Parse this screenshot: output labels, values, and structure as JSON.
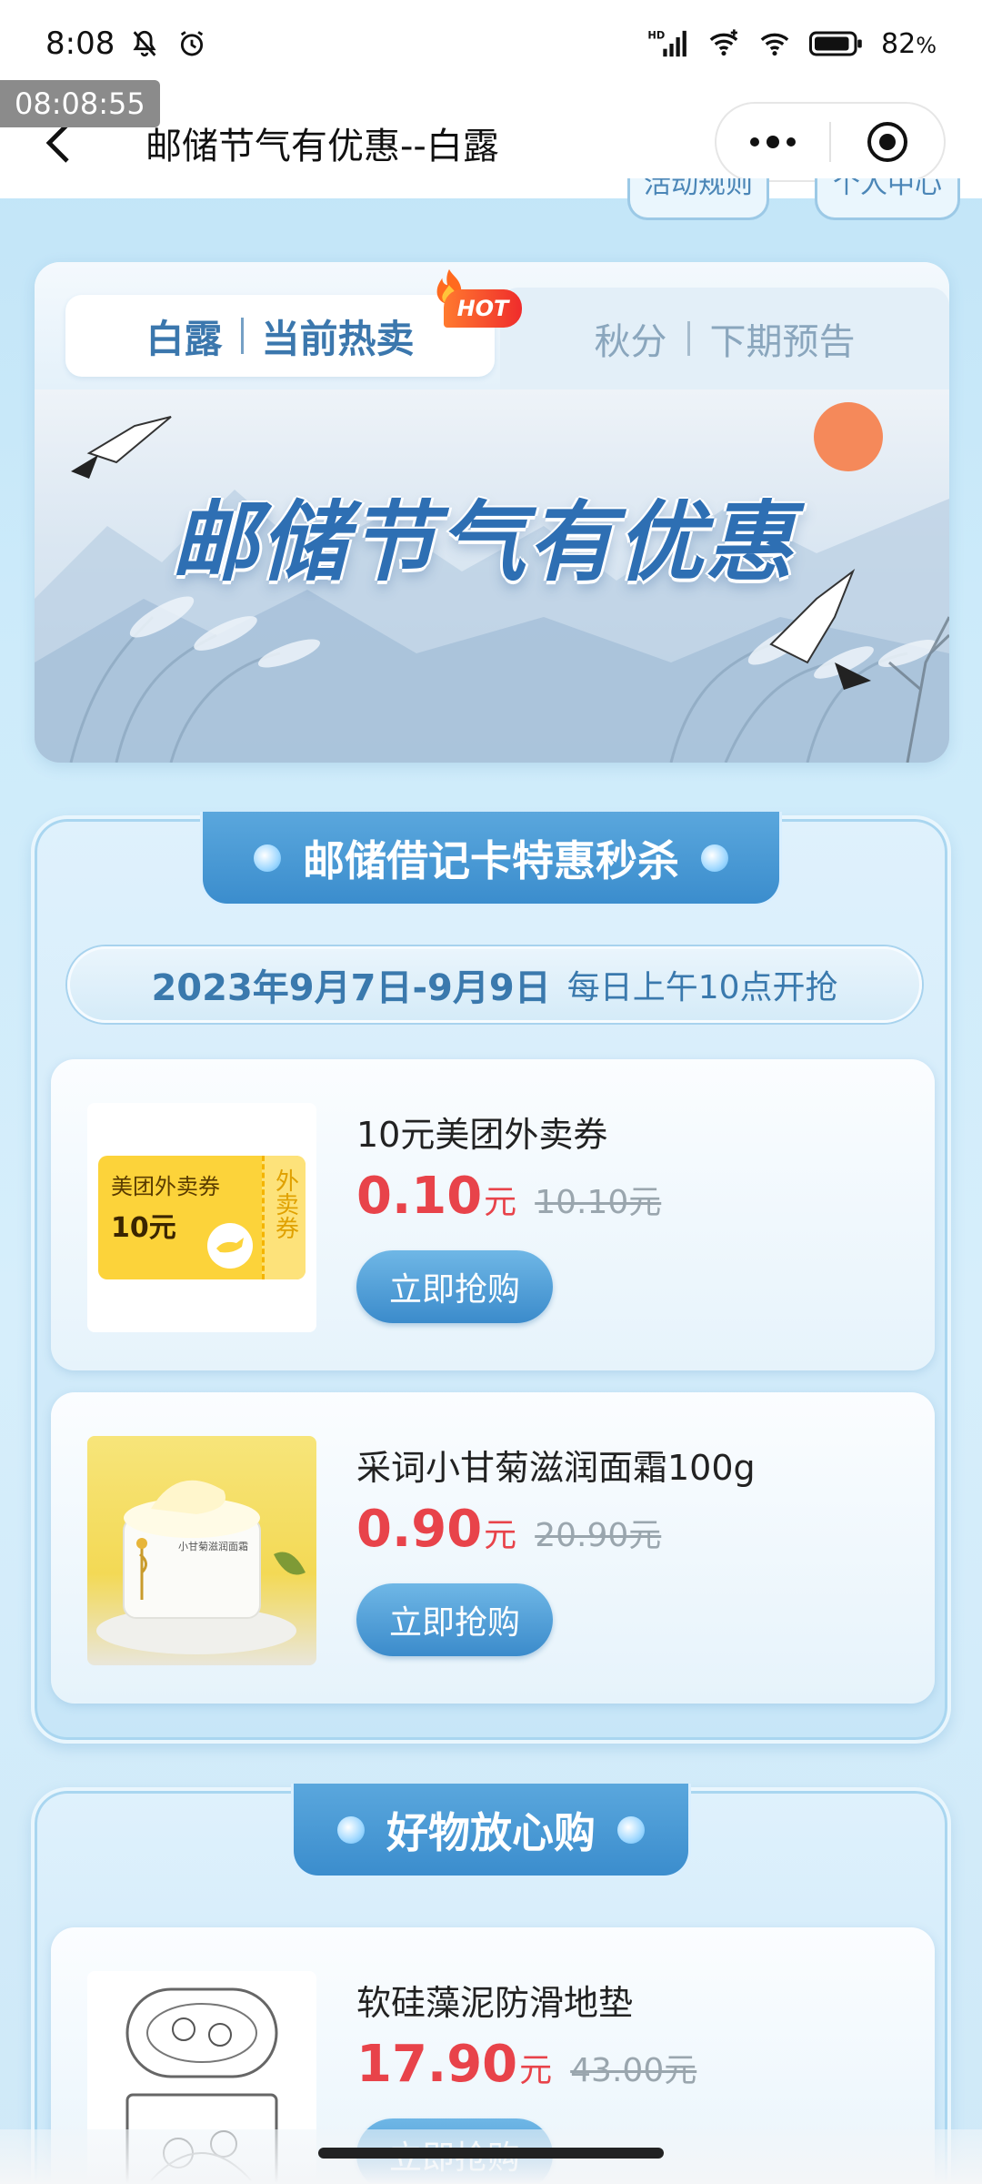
{
  "status_bar": {
    "time": "8:08",
    "battery": "82",
    "battery_unit": "%",
    "network_label": "HD",
    "time_overlay": "08:08:55"
  },
  "nav": {
    "title": "邮储节气有优惠--白露"
  },
  "top_links": {
    "rules": "活动规则",
    "personal": "个人中心"
  },
  "tabs": {
    "active": {
      "term": "白露",
      "label": "当前热卖",
      "badge": "HOT"
    },
    "inactive": {
      "term": "秋分",
      "label": "下期预告"
    }
  },
  "banner": {
    "title": "邮储节气有优惠"
  },
  "section1": {
    "title": "邮储借记卡特惠秒杀",
    "date": "2023年9月7日-9月9日",
    "time_note": "每日上午10点开抢",
    "products": [
      {
        "name": "10元美团外卖券",
        "price": "0.10",
        "unit": "元",
        "original": "10.10元",
        "button": "立即抢购",
        "coupon_title": "美团外卖券",
        "coupon_value": "10元",
        "coupon_side": "外卖券"
      },
      {
        "name": "采词小甘菊滋润面霜100g",
        "price": "0.90",
        "unit": "元",
        "original": "20.90元",
        "button": "立即抢购",
        "jar_label": "小甘菊滋润面霜"
      }
    ]
  },
  "section2": {
    "title": "好物放心购",
    "products": [
      {
        "name": "软硅藻泥防滑地垫",
        "price": "17.90",
        "unit": "元",
        "original": "43.00元",
        "button": "立即抢购"
      }
    ]
  },
  "colors": {
    "accent_blue": "#3b8dcd",
    "price_red": "#e8434a",
    "coupon_yellow": "#fcd33a"
  }
}
